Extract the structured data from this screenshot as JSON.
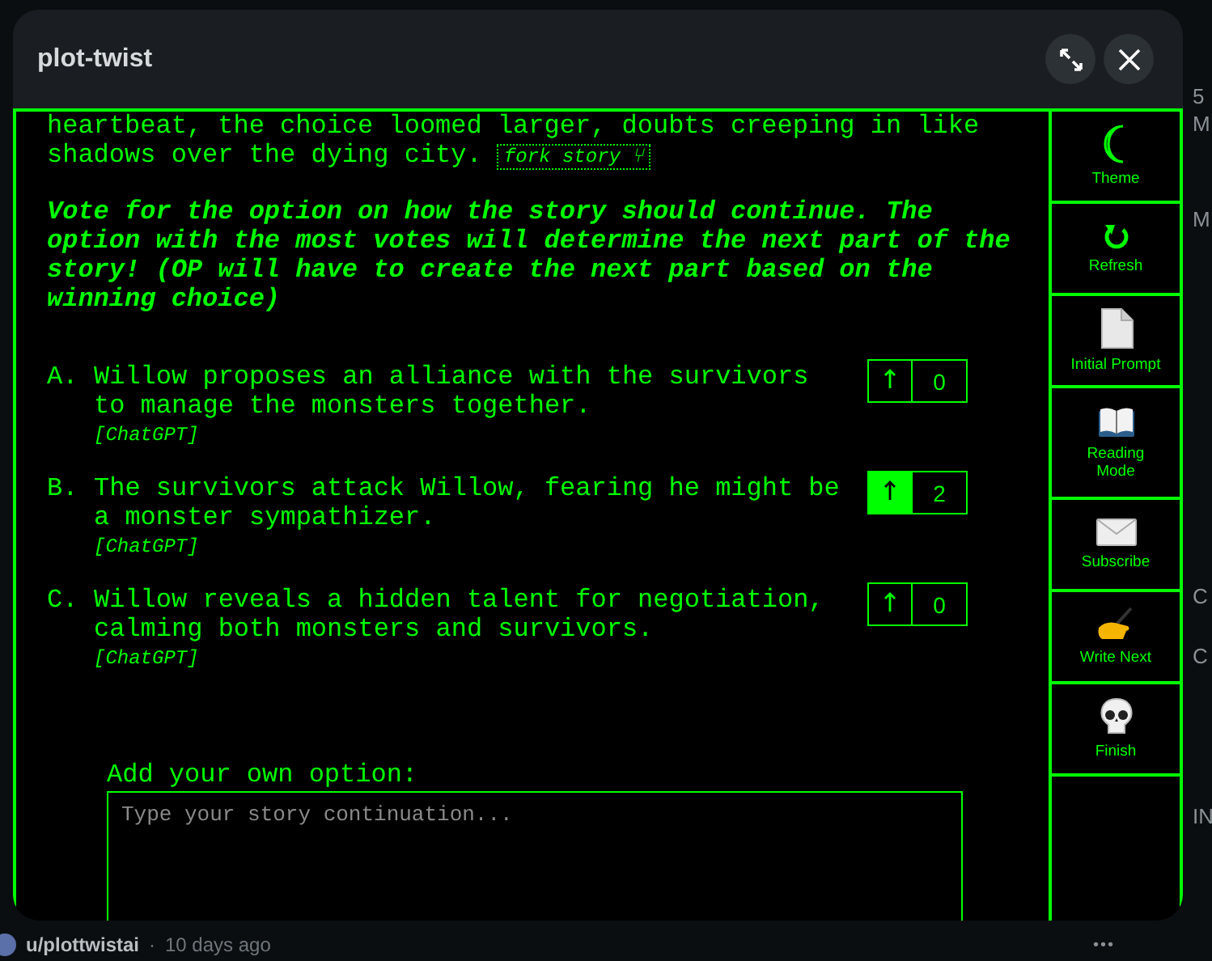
{
  "window": {
    "title": "plot-twist"
  },
  "story": {
    "text": "heartbeat, the choice loomed larger, doubts creeping in like shadows over the dying city.",
    "fork_link": "fork story ⑂"
  },
  "instructions": "Vote for the option on how the story should continue. The option with the most votes will determine the next part of the story! (OP will have to create the next part based on the winning choice)",
  "options": [
    {
      "letter": "A.",
      "text": "Willow proposes an alliance with the survivors to manage the monsters together.",
      "source": "[ChatGPT]",
      "votes": "0",
      "selected": false
    },
    {
      "letter": "B.",
      "text": "The survivors attack Willow, fearing he might be a monster sympathizer.",
      "source": "[ChatGPT]",
      "votes": "2",
      "selected": true
    },
    {
      "letter": "C.",
      "text": "Willow reveals a hidden talent for negotiation, calming both monsters and survivors.",
      "source": "[ChatGPT]",
      "votes": "0",
      "selected": false
    }
  ],
  "own_option": {
    "label": "Add your own option:",
    "placeholder": "Type your story continuation..."
  },
  "sidebar": {
    "items": [
      {
        "label": "Theme",
        "kind": "moon"
      },
      {
        "label": "Refresh",
        "kind": "refresh"
      },
      {
        "label": "Initial Prompt",
        "kind": "page"
      },
      {
        "label": "Reading Mode",
        "kind": "book"
      },
      {
        "label": "Subscribe",
        "kind": "envelope"
      },
      {
        "label": "Write Next",
        "kind": "writing"
      },
      {
        "label": "Finish",
        "kind": "skull"
      }
    ]
  },
  "background_fragments": [
    "5",
    "M",
    "M",
    "C",
    "C",
    "IN"
  ],
  "post_meta": {
    "author": "u/plottwistai",
    "separator": "·",
    "time": "10 days ago",
    "more": "•••"
  }
}
